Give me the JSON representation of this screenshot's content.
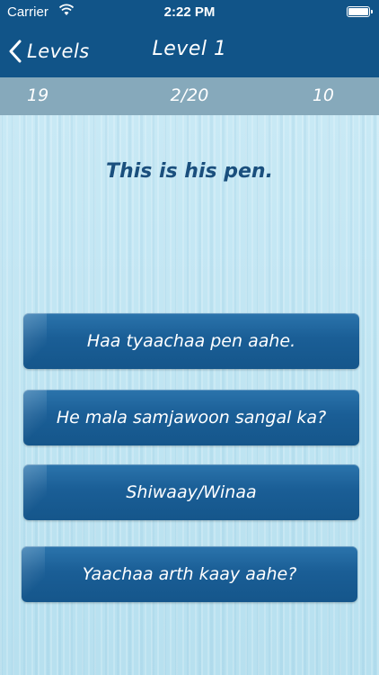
{
  "status": {
    "carrier": "Carrier",
    "time": "2:22 PM"
  },
  "nav": {
    "back_label": "Levels",
    "title": "Level 1"
  },
  "score": {
    "left": "19",
    "progress": "2/20",
    "right": "10"
  },
  "question": "This is his pen.",
  "answers": [
    "Haa tyaachaa pen aahe.",
    "He mala samjawoon sangal ka?",
    "Shiwaay/Winaa",
    "Yaachaa arth kaay aahe?"
  ],
  "colors": {
    "nav": "#115488",
    "score_bar": "#86a9bb",
    "answer": "#1a5e96",
    "question_text": "#1a4f7d"
  }
}
